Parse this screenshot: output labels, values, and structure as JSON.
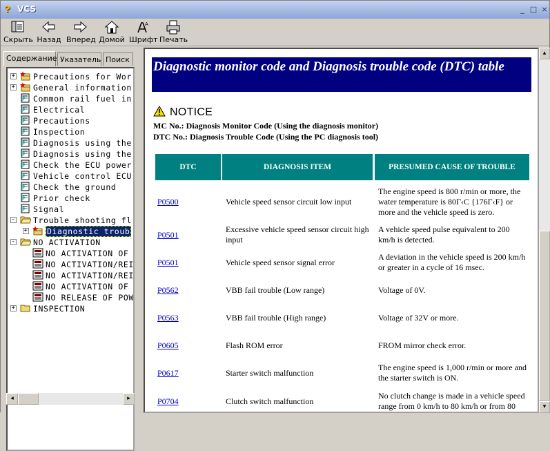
{
  "window": {
    "title": "VCS",
    "controls": {
      "minimize": "_",
      "maximize": "□",
      "close": "×"
    }
  },
  "toolbar": {
    "buttons": [
      {
        "label": "Скрыть",
        "icon": "hide-pane-icon"
      },
      {
        "label": "Назад",
        "icon": "back-arrow-icon"
      },
      {
        "label": "Вперед",
        "icon": "forward-arrow-icon"
      },
      {
        "label": "Домой",
        "icon": "home-icon"
      },
      {
        "label": "Шрифт",
        "icon": "font-icon"
      },
      {
        "label": "Печать",
        "icon": "printer-icon"
      }
    ]
  },
  "tabs": [
    {
      "label": "Содержание",
      "active": true
    },
    {
      "label": "Указатель",
      "active": false
    },
    {
      "label": "Поиск",
      "active": false
    }
  ],
  "tree": [
    {
      "label": "Precautions for Wor",
      "level": 0,
      "type": "book-star",
      "expander": "+"
    },
    {
      "label": "General information",
      "level": 0,
      "type": "book-star",
      "expander": "+"
    },
    {
      "label": "Common rail fuel in",
      "level": 0,
      "type": "page",
      "expander": ""
    },
    {
      "label": "Electrical",
      "level": 0,
      "type": "page",
      "expander": ""
    },
    {
      "label": "Precautions",
      "level": 0,
      "type": "page",
      "expander": ""
    },
    {
      "label": "Inspection",
      "level": 0,
      "type": "page",
      "expander": ""
    },
    {
      "label": "Diagnosis using the",
      "level": 0,
      "type": "page",
      "expander": ""
    },
    {
      "label": "Diagnosis using the",
      "level": 0,
      "type": "page",
      "expander": ""
    },
    {
      "label": "Check the ECU power",
      "level": 0,
      "type": "page",
      "expander": ""
    },
    {
      "label": "Vehicle control ECU",
      "level": 0,
      "type": "page",
      "expander": ""
    },
    {
      "label": "Check the ground",
      "level": 0,
      "type": "page",
      "expander": ""
    },
    {
      "label": "Prior check",
      "level": 0,
      "type": "page",
      "expander": ""
    },
    {
      "label": "Signal",
      "level": 0,
      "type": "page",
      "expander": ""
    },
    {
      "label": "Trouble shooting fl",
      "level": 0,
      "type": "folder-open",
      "expander": "-"
    },
    {
      "label": "Diagnostic troub",
      "level": 1,
      "type": "book-star",
      "expander": "+",
      "selected": true
    },
    {
      "label": "NO ACTIVATION",
      "level": 0,
      "type": "folder-open",
      "expander": "-"
    },
    {
      "label": "NO ACTIVATION OF",
      "level": 1,
      "type": "doc",
      "expander": ""
    },
    {
      "label": "NO ACTIVATION/REI",
      "level": 1,
      "type": "doc",
      "expander": ""
    },
    {
      "label": "NO ACTIVATION/REI",
      "level": 1,
      "type": "doc",
      "expander": ""
    },
    {
      "label": "NO ACTIVATION OF",
      "level": 1,
      "type": "doc",
      "expander": ""
    },
    {
      "label": "NO RELEASE OF POW",
      "level": 1,
      "type": "doc",
      "expander": ""
    },
    {
      "label": "INSPECTION",
      "level": 0,
      "type": "folder-closed",
      "expander": "+"
    }
  ],
  "content": {
    "heading": "Diagnostic monitor code and Diagnosis trouble code (DTC) table",
    "notice_label": "NOTICE",
    "notes": [
      "MC No.: Diagnosis Monitor Code (Using the diagnosis monitor)",
      "DTC No.: Diagnosis Trouble Code (Using the PC diagnosis tool)"
    ],
    "table": {
      "headers": [
        "DTC",
        "DIAGNOSIS ITEM",
        "PRESUMED CAUSE OF TROUBLE"
      ],
      "rows": [
        {
          "code": "P0500",
          "item": "Vehicle speed sensor circuit low input",
          "cause": "The engine speed is 800 r/min or more, the water temperature is 80Г‹C {176Г‹F} or more and the vehicle speed is zero."
        },
        {
          "code": "P0501",
          "item": "Excessive vehicle speed sensor circuit high input",
          "cause": "A vehicle speed pulse equivalent to 200 km/h is detected."
        },
        {
          "code": "P0501",
          "item": "Vehicle speed sensor signal error",
          "cause": "A deviation in the vehicle speed is 200 km/h or greater in a cycle of 16 msec."
        },
        {
          "code": "P0562",
          "item": "VBB fail trouble (Low range)",
          "cause": "Voltage of 0V."
        },
        {
          "code": "P0563",
          "item": "VBB fail trouble (High range)",
          "cause": "Voltage of 32V or more."
        },
        {
          "code": "P0605",
          "item": "Flash ROM error",
          "cause": "FROM mirror check error."
        },
        {
          "code": "P0617",
          "item": "Starter switch malfunction",
          "cause": "The engine speed is 1,000 r/min or more and the starter switch is ON."
        },
        {
          "code": "P0704",
          "item": "Clutch switch malfunction",
          "cause": "No clutch change is made in a vehicle speed range from 0 km/h to 80 km/h or from 80"
        }
      ]
    }
  },
  "colors": {
    "heading_bg": "#000080",
    "table_header_bg": "#008080",
    "link": "#0000cc",
    "selection": "#0a246a"
  }
}
